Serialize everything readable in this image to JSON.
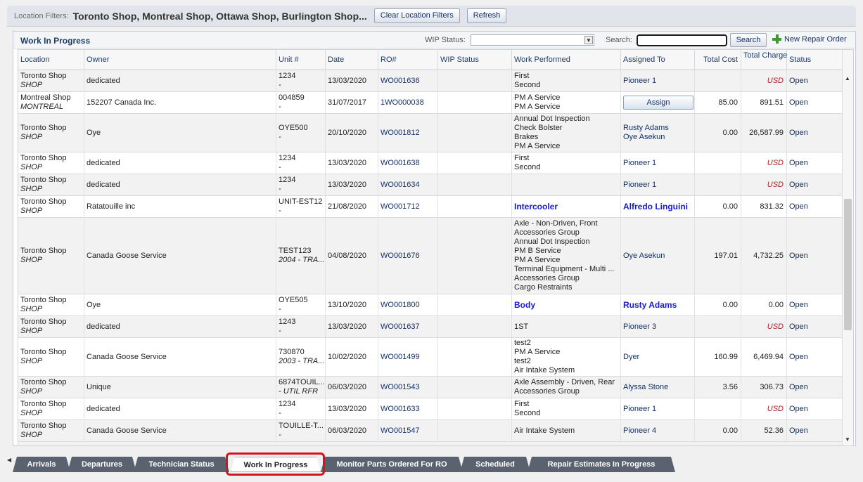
{
  "filters": {
    "label": "Location Filters:",
    "value": "Toronto Shop, Montreal Shop, Ottawa Shop, Burlington Shop...",
    "clear_label": "Clear Location Filters",
    "refresh_label": "Refresh"
  },
  "panel": {
    "title": "Work In Progress",
    "wip_status_label": "WIP Status:",
    "wip_status_value": "",
    "search_label": "Search:",
    "search_value": "",
    "search_button": "Search",
    "new_repair_order": "New Repair Order"
  },
  "columns": {
    "location": "Location",
    "owner": "Owner",
    "unit": "Unit #",
    "date": "Date",
    "ro": "RO#",
    "wip_status": "WIP Status",
    "work_performed": "Work Performed",
    "assigned_to": "Assigned To",
    "total_cost": "Total Cost",
    "total_charge_1": "Total",
    "total_charge_2": "Charge",
    "status": "Status"
  },
  "rows": [
    {
      "loc": "Toronto Shop",
      "loc2": "SHOP",
      "owner": "dedicated",
      "unit": "1234",
      "unit2": "-",
      "date": "13/03/2020",
      "ro": "WO001636",
      "work": [
        "First",
        "Second"
      ],
      "work_bold": false,
      "assigned": [
        "Pioneer 1"
      ],
      "assigned_bold": false,
      "assign_button": false,
      "cost": "",
      "charge": "USD",
      "charge_usd": true,
      "status": "Open"
    },
    {
      "loc": "Montreal Shop",
      "loc2": "MONTREAL",
      "owner": "152207 Canada Inc.",
      "unit": "004859",
      "unit2": "-",
      "date": "31/07/2017",
      "ro": "1WO000038",
      "work": [
        "PM A Service",
        "PM A Service"
      ],
      "work_bold": false,
      "assigned": [],
      "assigned_bold": false,
      "assign_button": true,
      "assign_label": "Assign",
      "cost": "85.00",
      "charge": "891.51",
      "charge_usd": false,
      "status": "Open"
    },
    {
      "loc": "Toronto Shop",
      "loc2": "SHOP",
      "owner": "Oye",
      "unit": "OYE500",
      "unit2": "-",
      "date": "20/10/2020",
      "ro": "WO001812",
      "work": [
        "Annual Dot Inspection",
        "Check Bolster",
        "Brakes",
        "PM A Service"
      ],
      "work_bold": false,
      "assigned": [
        "Rusty Adams",
        "Oye Asekun"
      ],
      "assigned_bold": false,
      "assign_button": false,
      "cost": "0.00",
      "charge": "26,587.99",
      "charge_usd": false,
      "status": "Open"
    },
    {
      "loc": "Toronto Shop",
      "loc2": "SHOP",
      "owner": "dedicated",
      "unit": "1234",
      "unit2": "-",
      "date": "13/03/2020",
      "ro": "WO001638",
      "work": [
        "First",
        "Second"
      ],
      "work_bold": false,
      "assigned": [
        "Pioneer 1"
      ],
      "assigned_bold": false,
      "assign_button": false,
      "cost": "",
      "charge": "USD",
      "charge_usd": true,
      "status": "Open"
    },
    {
      "loc": "Toronto Shop",
      "loc2": "SHOP",
      "owner": "dedicated",
      "unit": "1234",
      "unit2": "-",
      "date": "13/03/2020",
      "ro": "WO001634",
      "work": [],
      "work_bold": false,
      "assigned": [
        "Pioneer 1"
      ],
      "assigned_bold": false,
      "assign_button": false,
      "cost": "",
      "charge": "USD",
      "charge_usd": true,
      "status": "Open"
    },
    {
      "loc": "Toronto Shop",
      "loc2": "SHOP",
      "owner": "Ratatouille inc",
      "unit": "UNIT-EST12",
      "unit2": "-",
      "date": "21/08/2020",
      "ro": "WO001712",
      "work": [
        "Intercooler"
      ],
      "work_bold": true,
      "assigned": [
        "Alfredo Linguini"
      ],
      "assigned_bold": true,
      "assign_button": false,
      "cost": "0.00",
      "charge": "831.32",
      "charge_usd": false,
      "status": "Open"
    },
    {
      "loc": "Toronto Shop",
      "loc2": "SHOP",
      "owner": "Canada Goose Service",
      "unit": "TEST123",
      "unit2": "2004 - TRA...",
      "date": "04/08/2020",
      "ro": "WO001676",
      "work": [
        "Axle - Non-Driven, Front",
        "Accessories Group",
        "Annual Dot Inspection",
        "PM B Service",
        "PM A Service",
        "Terminal Equipment - Multi ...",
        "Accessories Group",
        "Cargo Restraints"
      ],
      "work_bold": false,
      "assigned": [
        "Oye Asekun"
      ],
      "assigned_bold": false,
      "assign_button": false,
      "cost": "197.01",
      "charge": "4,732.25",
      "charge_usd": false,
      "status": "Open"
    },
    {
      "loc": "Toronto Shop",
      "loc2": "SHOP",
      "owner": "Oye",
      "unit": "OYE505",
      "unit2": "-",
      "date": "13/10/2020",
      "ro": "WO001800",
      "work": [
        "Body"
      ],
      "work_bold": true,
      "assigned": [
        "Rusty Adams"
      ],
      "assigned_bold": true,
      "assign_button": false,
      "cost": "0.00",
      "charge": "0.00",
      "charge_usd": false,
      "status": "Open"
    },
    {
      "loc": "Toronto Shop",
      "loc2": "SHOP",
      "owner": "dedicated",
      "unit": "1243",
      "unit2": "-",
      "date": "13/03/2020",
      "ro": "WO001637",
      "work": [
        "1ST"
      ],
      "work_bold": false,
      "assigned": [
        "Pioneer 3"
      ],
      "assigned_bold": false,
      "assign_button": false,
      "cost": "",
      "charge": "USD",
      "charge_usd": true,
      "status": "Open"
    },
    {
      "loc": "Toronto Shop",
      "loc2": "SHOP",
      "owner": "Canada Goose Service",
      "unit": "730870",
      "unit2": "2003 - TRA...",
      "date": "10/02/2020",
      "ro": "WO001499",
      "work": [
        "test2",
        "PM A Service",
        "test2",
        "Air Intake System"
      ],
      "work_bold": false,
      "assigned": [
        "Dyer"
      ],
      "assigned_bold": false,
      "assign_button": false,
      "cost": "160.99",
      "charge": "6,469.94",
      "charge_usd": false,
      "status": "Open"
    },
    {
      "loc": "Toronto Shop",
      "loc2": "SHOP",
      "owner": "Unique",
      "unit": "6874TOUIL...",
      "unit2": "- UTIL RFR",
      "date": "06/03/2020",
      "ro": "WO001543",
      "work": [
        "Axle Assembly - Driven, Rear",
        "Accessories Group"
      ],
      "work_bold": false,
      "assigned": [
        "Alyssa Stone"
      ],
      "assigned_bold": false,
      "assign_button": false,
      "cost": "3.56",
      "charge": "306.73",
      "charge_usd": false,
      "status": "Open"
    },
    {
      "loc": "Toronto Shop",
      "loc2": "SHOP",
      "owner": "dedicated",
      "unit": "1234",
      "unit2": "-",
      "date": "13/03/2020",
      "ro": "WO001633",
      "work": [
        "First",
        "Second"
      ],
      "work_bold": false,
      "assigned": [
        "Pioneer 1"
      ],
      "assigned_bold": false,
      "assign_button": false,
      "cost": "",
      "charge": "USD",
      "charge_usd": true,
      "status": "Open"
    },
    {
      "loc": "Toronto Shop",
      "loc2": "SHOP",
      "owner": "Canada Goose Service",
      "unit": "TOUILLE-T...",
      "unit2": "-",
      "date": "06/03/2020",
      "ro": "WO001547",
      "work": [
        "Air Intake System"
      ],
      "work_bold": false,
      "assigned": [
        "Pioneer 4"
      ],
      "assigned_bold": false,
      "assign_button": false,
      "cost": "0.00",
      "charge": "52.36",
      "charge_usd": false,
      "status": "Open"
    }
  ],
  "tabs": [
    "Arrivals",
    "Departures",
    "Technician Status",
    "Work In Progress",
    "Monitor Parts Ordered For RO",
    "Scheduled",
    "Repair Estimates In Progress"
  ],
  "active_tab": "Work In Progress",
  "colors": {
    "link": "#12316b",
    "bold_link": "#1a1ad6",
    "usd": "#b01e1e",
    "highlight": "#d4161b",
    "tab": "#5a6270"
  }
}
